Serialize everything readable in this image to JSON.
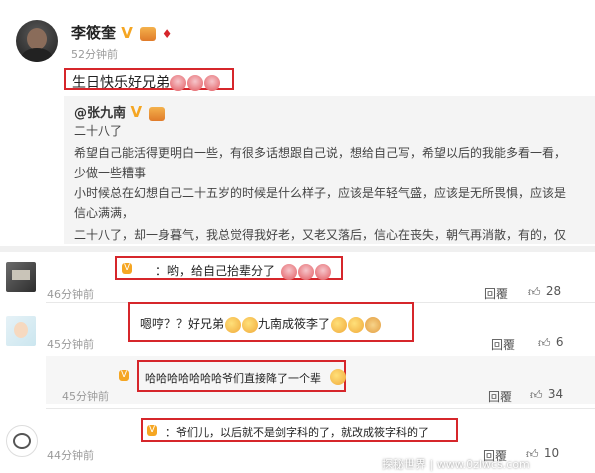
{
  "post": {
    "author": "李筱奎",
    "time": "52分钟前",
    "content": "生日快乐好兄弟"
  },
  "quoted": {
    "author": "@张九南",
    "lines": [
      "二十八了",
      "希望自己能活得更明白一些，有很多话想跟自己说，想给自己写，希望以后的我能多看一看，",
      "少做一些糟事",
      "小时候总在幻想自己二十五岁的时候是什么样子，应该是年轻气盛，应该是无所畏惧，应该是",
      "信心满满，",
      "二十八了，却一身暮气，我总觉得我好老，又老又落后，信心在丧失，朝气再消散，有的，仅"
    ]
  },
  "comments": [
    {
      "text": "：哟，给自己抬辈分了",
      "time": "46分钟前",
      "reply": "回覆",
      "likes": "28"
    },
    {
      "text_a": "嗯哼？？好兄弟",
      "text_b": "九南成筱李了",
      "time": "45分钟前",
      "reply": "回覆",
      "likes": "6"
    },
    {
      "text": "哈哈哈哈哈哈哈爷们直接降了一个辈",
      "time": "45分钟前",
      "reply": "回覆",
      "likes": "34"
    },
    {
      "text": "：爷们儿，以后就不是剑字科的了，就改成筱字科的了",
      "time": "44分钟前",
      "reply": "回覆",
      "likes": "10"
    }
  ],
  "watermark": "探秘世界 | www.0zlwcs.com",
  "colors": {
    "highlight_border": "#d6262b",
    "quote_bg": "#f4f4f4",
    "reply_bg": "#f6f6f6"
  }
}
